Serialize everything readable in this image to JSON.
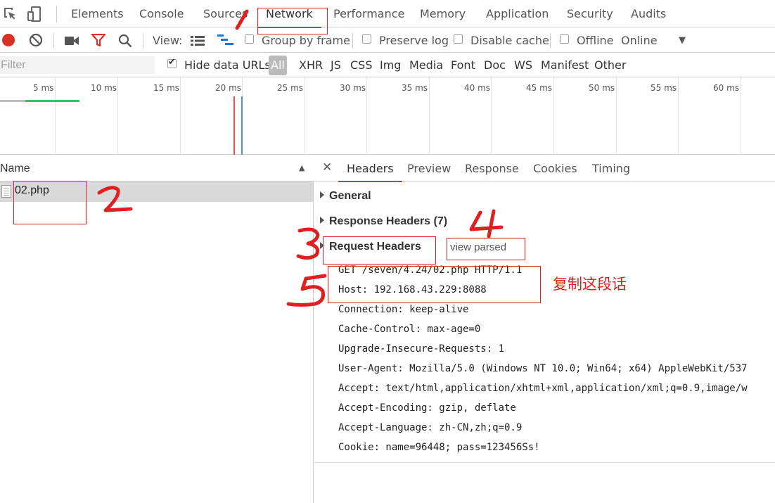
{
  "tabs": [
    "Elements",
    "Console",
    "Sources",
    "Network",
    "Performance",
    "Memory",
    "Application",
    "Security",
    "Audits"
  ],
  "active_tab": "Network",
  "toolbar": {
    "view_label": "View:",
    "group_by_frame": "Group by frame",
    "preserve_log": "Preserve log",
    "disable_cache": "Disable cache",
    "offline": "Offline",
    "throttle": "Online",
    "accent_record": "#d93025",
    "accent_filter": "#d93025"
  },
  "filterbar": {
    "placeholder": "Filter",
    "hide_data_urls": "Hide data URLs",
    "types": [
      "All",
      "XHR",
      "JS",
      "CSS",
      "Img",
      "Media",
      "Font",
      "Doc",
      "WS",
      "Manifest",
      "Other"
    ]
  },
  "timeline": {
    "ticks": [
      "5 ms",
      "10 ms",
      "15 ms",
      "20 ms",
      "25 ms",
      "30 ms",
      "35 ms",
      "40 ms",
      "45 ms",
      "50 ms",
      "55 ms",
      "60 ms"
    ]
  },
  "requests": {
    "header_name": "Name",
    "items": [
      {
        "name": "02.php"
      }
    ]
  },
  "details": {
    "tabs": [
      "Headers",
      "Preview",
      "Response",
      "Cookies",
      "Timing"
    ],
    "sections": {
      "general": "General",
      "response_headers": "Response Headers (7)",
      "request_headers": "Request Headers",
      "view_parsed": "view parsed"
    },
    "request_lines": [
      "GET /seven/4.24/02.php HTTP/1.1",
      "Host: 192.168.43.229:8088",
      "Connection: keep-alive",
      "Cache-Control: max-age=0",
      "Upgrade-Insecure-Requests: 1",
      "User-Agent: Mozilla/5.0 (Windows NT 10.0; Win64; x64) AppleWebKit/537",
      "Accept: text/html,application/xhtml+xml,application/xml;q=0.9,image/w",
      "Accept-Encoding: gzip, deflate",
      "Accept-Language: zh-CN,zh;q=0.9",
      "Cookie: name=96448; pass=123456Ss!"
    ]
  },
  "annotations": {
    "note": "复制这段话",
    "color": "#e02020"
  }
}
